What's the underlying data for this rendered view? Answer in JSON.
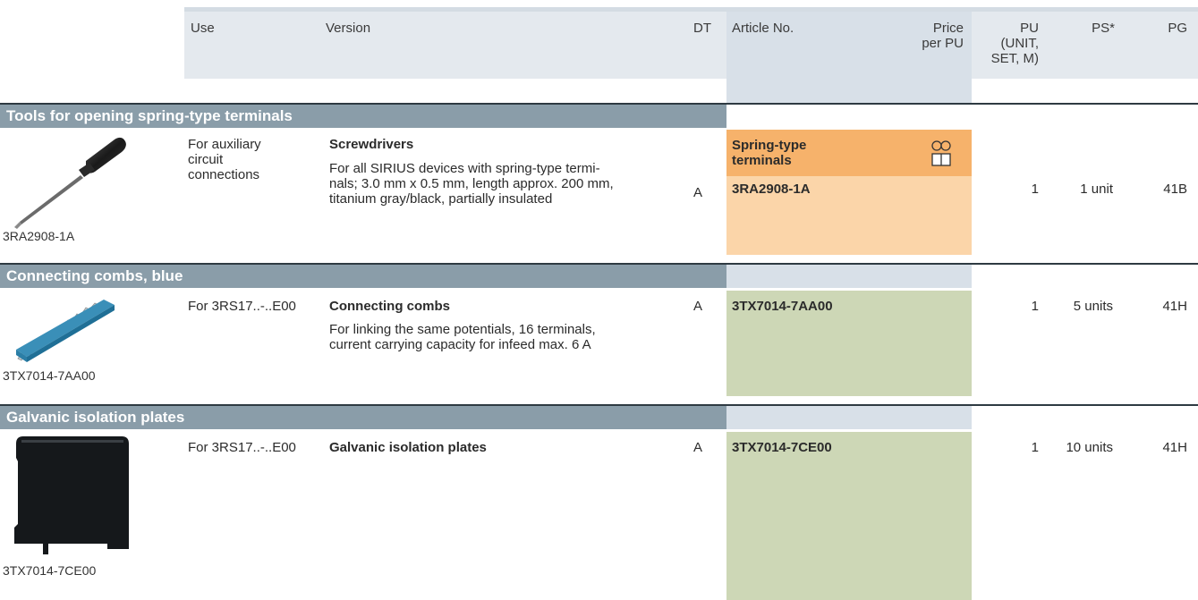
{
  "header": {
    "use": "Use",
    "version": "Version",
    "dt": "DT",
    "article_no": "Article No.",
    "price_line1": "Price",
    "price_line2": "per PU",
    "pu_line1": "PU",
    "pu_line2": "(UNIT,",
    "pu_line3": "SET, M)",
    "ps": "PS*",
    "pg": "PG"
  },
  "sections": [
    {
      "title": "Tools for opening spring-type terminals",
      "image_caption": "3RA2908-1A",
      "use_lines": [
        "For auxiliary",
        "circuit",
        "connections"
      ],
      "version_title": "Screwdrivers",
      "version_lines": [
        "For all SIRIUS devices with spring-type termi-",
        "nals; 3.0 mm x 0.5 mm, length approx. 200 mm,",
        "titanium gray/black, partially insulated"
      ],
      "dt": "A",
      "terminal_label_line1": "Spring-type",
      "terminal_label_line2": "terminals",
      "article_no": "3RA2908-1A",
      "pu": "1",
      "ps": "1 unit",
      "pg": "41B"
    },
    {
      "title": "Connecting combs, blue",
      "image_caption": "3TX7014-7AA00",
      "use_lines": [
        "For 3RS17..-..E00"
      ],
      "version_title": "Connecting combs",
      "version_lines": [
        "For linking the same potentials, 16 terminals,",
        "current carrying capacity for infeed max. 6 A"
      ],
      "dt": "A",
      "article_no": "3TX7014-7AA00",
      "pu": "1",
      "ps": "5 units",
      "pg": "41H"
    },
    {
      "title": "Galvanic isolation plates",
      "image_caption": "3TX7014-7CE00",
      "use_lines": [
        "For 3RS17..-..E00"
      ],
      "version_title": "Galvanic isolation plates",
      "version_lines": [],
      "dt": "A",
      "article_no": "3TX7014-7CE00",
      "pu": "1",
      "ps": "10 units",
      "pg": "41H"
    }
  ],
  "colors": {
    "section_bar": "#8a9da9",
    "header_band": "#e4e9ee",
    "article_column": "#d8e0e8",
    "spring_header": "#f6b26b",
    "spring_body": "#fbd5a9",
    "article_green": "#cdd7b6"
  }
}
